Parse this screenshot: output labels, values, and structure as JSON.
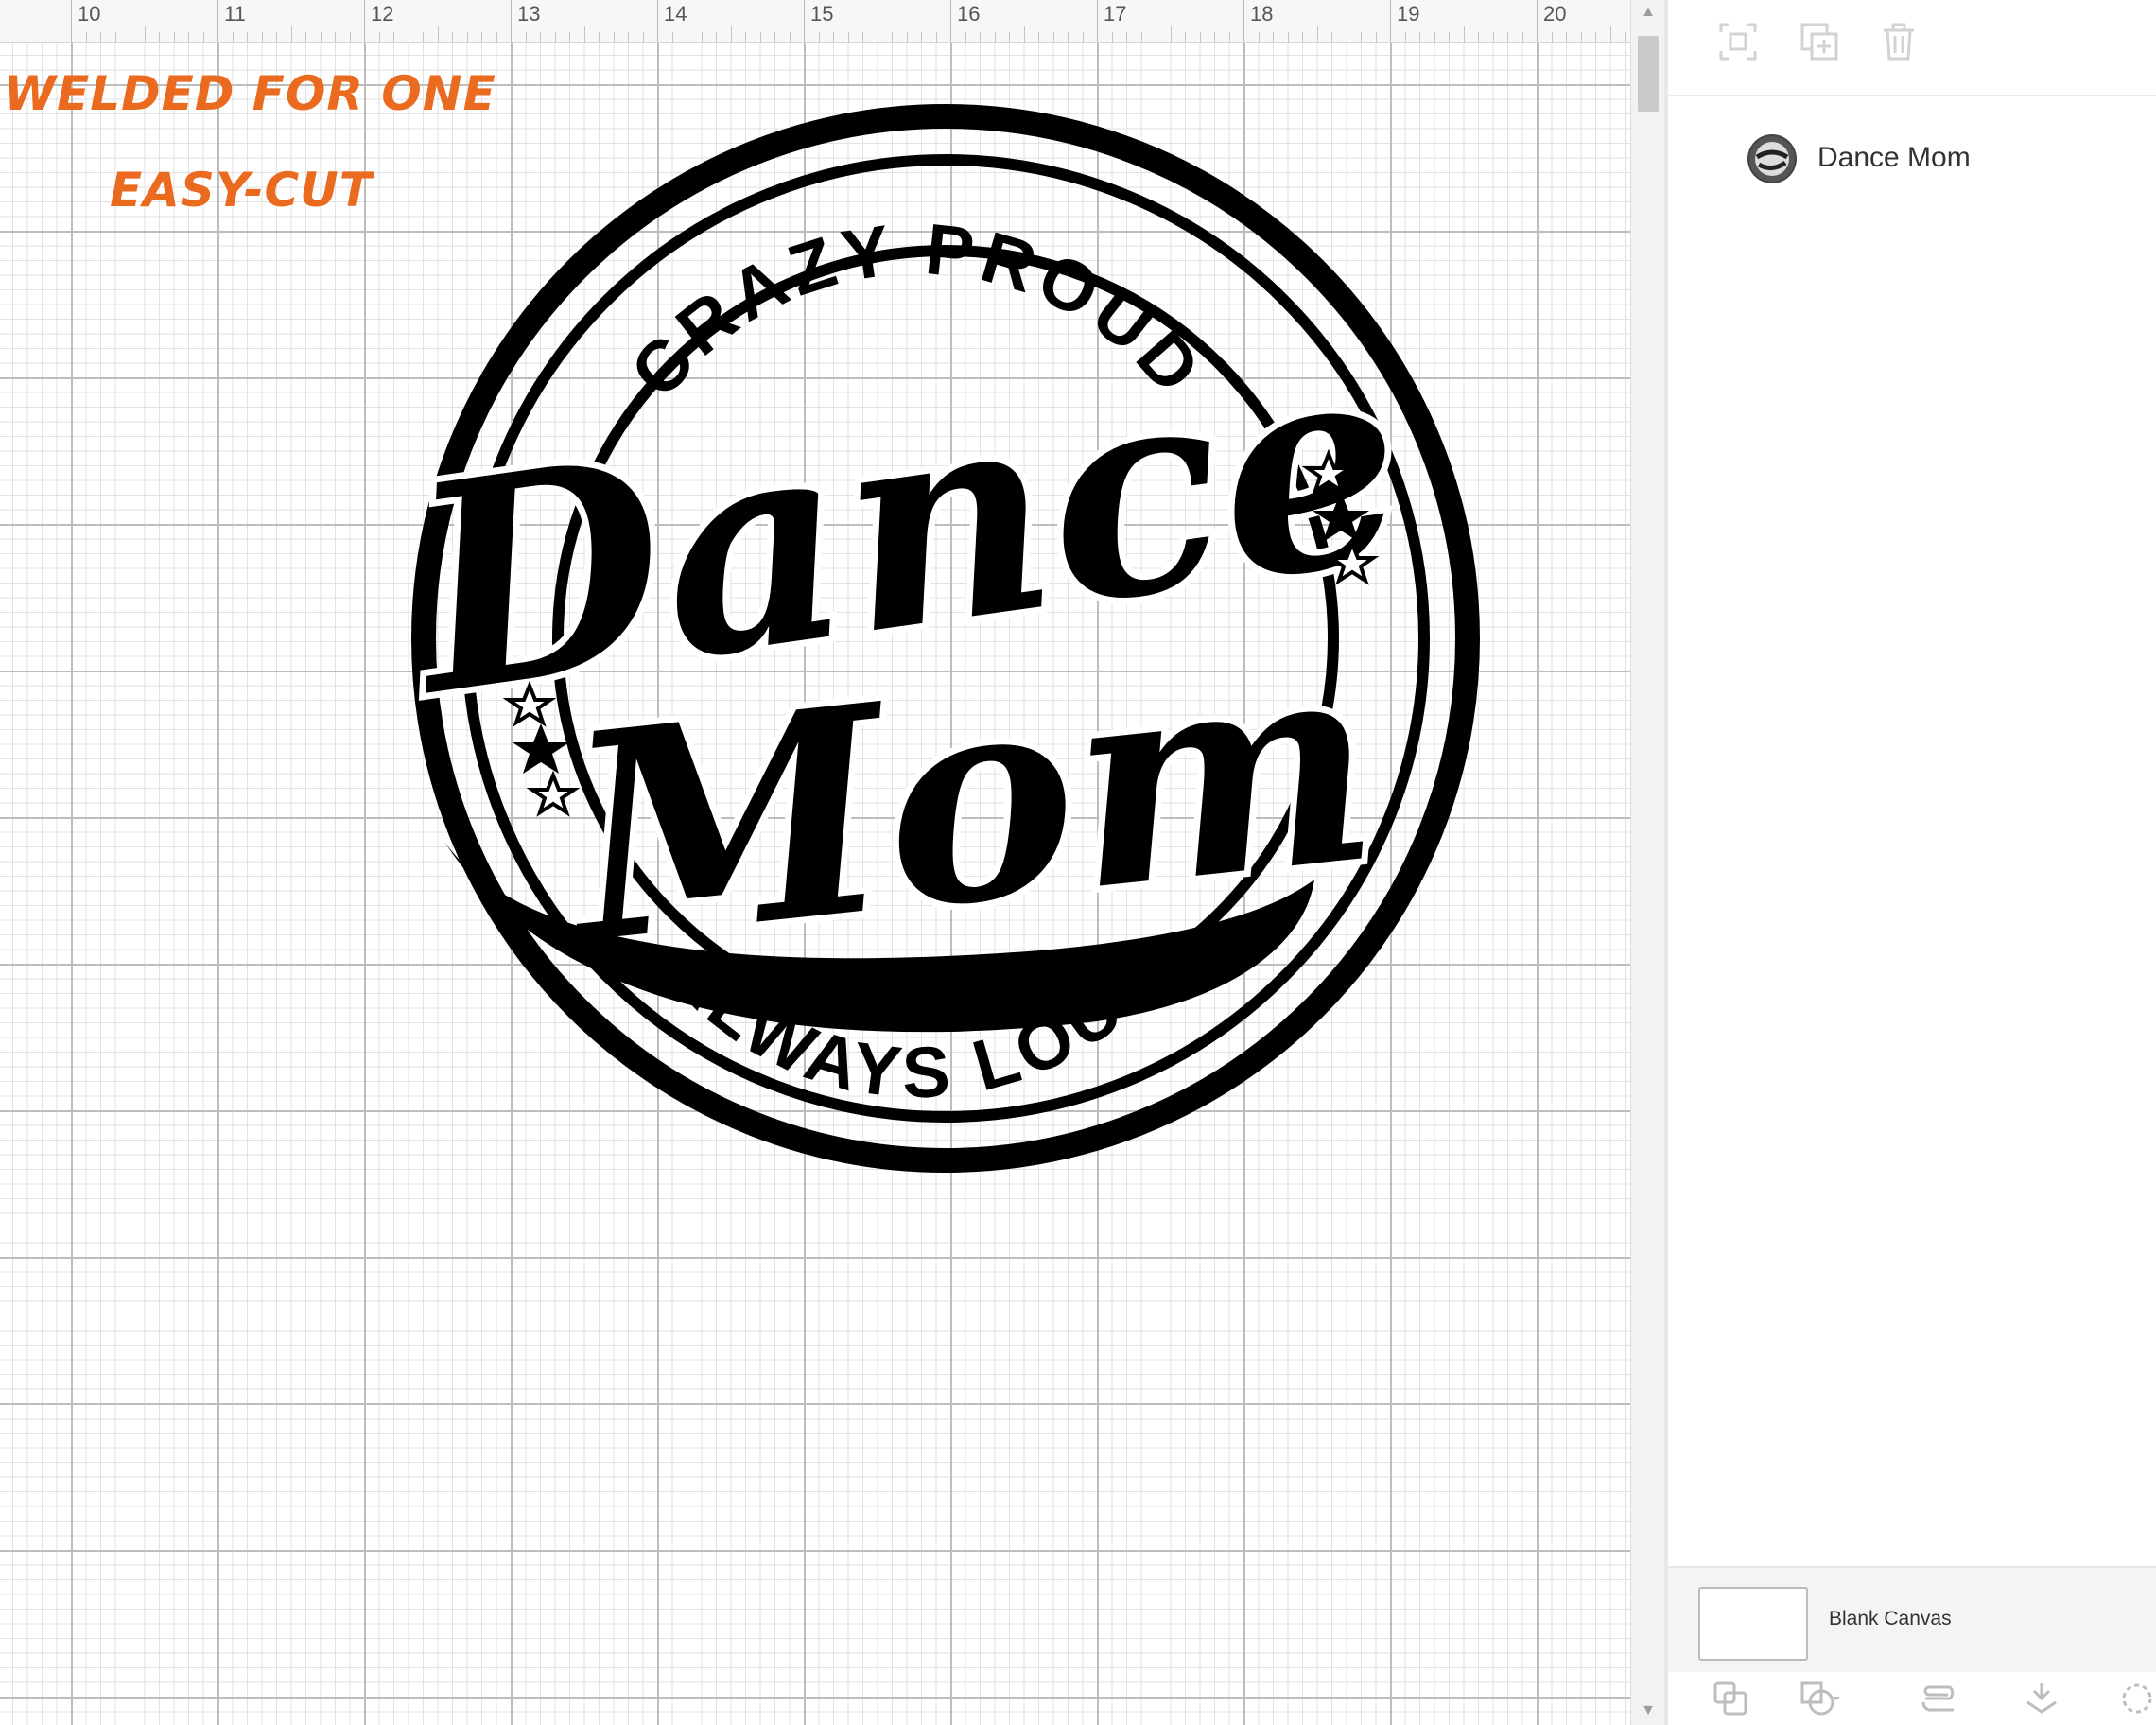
{
  "ruler": {
    "ticks": [
      "10",
      "11",
      "12",
      "13",
      "14",
      "15",
      "16",
      "17",
      "18",
      "19",
      "20"
    ]
  },
  "notes": {
    "line1": "WELDED FOR ONE",
    "line2": "EASY-CUT"
  },
  "design": {
    "top_text": "CRAZY PROUD",
    "script_line1": "Dance",
    "script_line2": "Mom",
    "bottom_text": "ALWAYS LOUD"
  },
  "layers": {
    "items": [
      {
        "name": "Dance Mom"
      }
    ]
  },
  "canvas": {
    "label": "Blank Canvas"
  },
  "toolbar": {
    "icons": [
      "group-icon",
      "duplicate-icon",
      "delete-icon"
    ]
  },
  "bottom_toolbar": {
    "icons": [
      "slice-icon",
      "combine-icon",
      "attach-icon",
      "flatten-icon",
      "contour-icon"
    ]
  },
  "colors": {
    "note": "#ea6a1f",
    "design": "#000000",
    "grid_major": "#bdbdbd",
    "grid_minor": "#e2e2e2"
  }
}
